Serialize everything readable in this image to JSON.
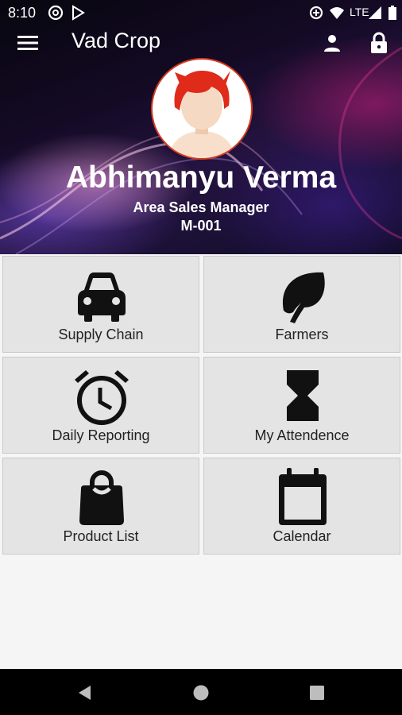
{
  "status_bar": {
    "time": "8:10",
    "network": "LTE",
    "icons": [
      "at-sign-icon",
      "play-store-icon",
      "data-saver-icon",
      "wifi-icon",
      "signal-icon",
      "battery-icon"
    ]
  },
  "app_bar": {
    "title": "Vad Crop",
    "menu_icon": "hamburger-menu-icon",
    "profile_icon": "person-icon",
    "lock_icon": "lock-icon"
  },
  "profile": {
    "name": "Abhimanyu Verma",
    "role": "Area Sales Manager",
    "code": "M-001"
  },
  "tiles": [
    {
      "label": "Supply Chain",
      "icon": "car-icon"
    },
    {
      "label": "Farmers",
      "icon": "leaf-icon"
    },
    {
      "label": "Daily Reporting",
      "icon": "alarm-clock-icon"
    },
    {
      "label": "My Attendence",
      "icon": "hourglass-icon"
    },
    {
      "label": "Product List",
      "icon": "shopping-bag-icon"
    },
    {
      "label": "Calendar",
      "icon": "calendar-icon"
    }
  ],
  "nav_bar": {
    "back": "back-triangle-icon",
    "home": "home-circle-icon",
    "recents": "recents-square-icon"
  },
  "colors": {
    "header_dark": "#0d0a1e",
    "tile_bg": "#e4e4e4",
    "avatar_border": "#d43a1f",
    "hair": "#e02a1a"
  }
}
